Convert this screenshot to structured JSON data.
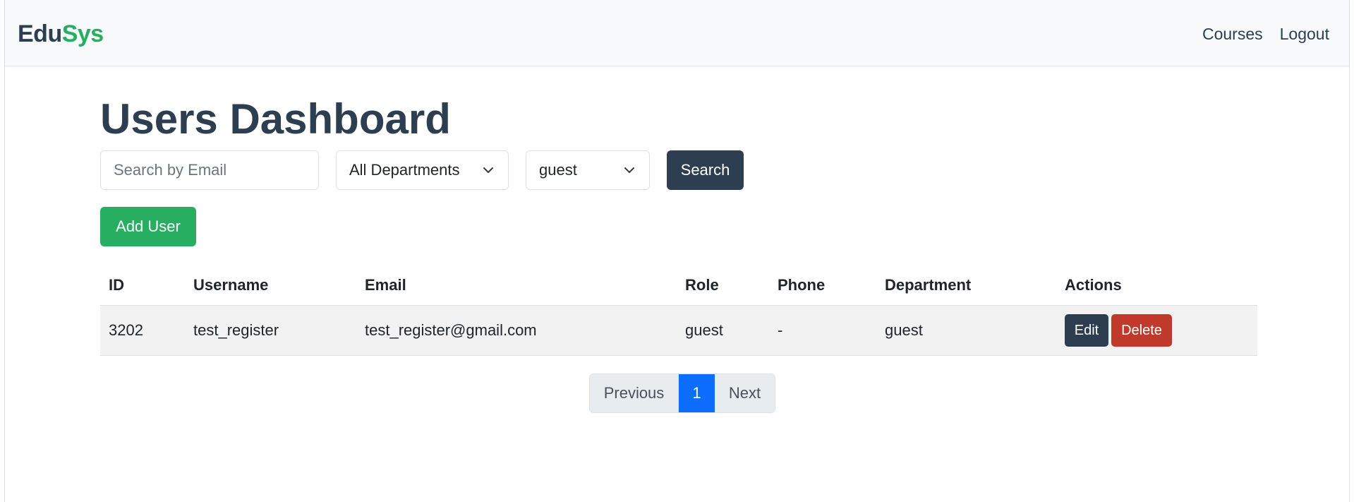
{
  "navbar": {
    "brand_part1": "Edu",
    "brand_part2": "Sys",
    "links": [
      "Courses",
      "Logout"
    ]
  },
  "page": {
    "title": "Users Dashboard"
  },
  "filters": {
    "search_placeholder": "Search by Email",
    "search_value": "",
    "department_selected": "All Departments",
    "role_selected": "guest",
    "search_button": "Search"
  },
  "actions": {
    "add_user_label": "Add User"
  },
  "table": {
    "columns": [
      "ID",
      "Username",
      "Email",
      "Role",
      "Phone",
      "Department",
      "Actions"
    ],
    "rows": [
      {
        "id": "3202",
        "username": "test_register",
        "email": "test_register@gmail.com",
        "role": "guest",
        "phone": "-",
        "department": "guest",
        "edit_label": "Edit",
        "delete_label": "Delete"
      }
    ]
  },
  "pagination": {
    "previous": "Previous",
    "current_page": "1",
    "next": "Next"
  },
  "colors": {
    "brand_dark": "#2c3e50",
    "brand_green": "#27ae60",
    "danger": "#c0392b",
    "active_page": "#0d6efd"
  }
}
